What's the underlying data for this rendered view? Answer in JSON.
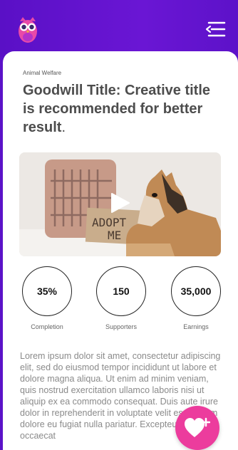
{
  "colors": {
    "header": "#5b12c8",
    "accent": "#ec3c9d",
    "title": "#4d4d4d",
    "body_text": "#8a8a8a"
  },
  "header": {
    "logo_icon": "owl-icon",
    "menu_icon": "menu-collapse-icon"
  },
  "article": {
    "category": "Animal Welfare",
    "title": "Goodwill Title: Creative title is recommended for better result",
    "title_end": ".",
    "video": {
      "play_icon": "play-icon",
      "sign_text_1": "ADOPT",
      "sign_text_2": "ME"
    }
  },
  "stats": [
    {
      "value": "35%",
      "label": "Completion"
    },
    {
      "value": "150",
      "label": "Supporters"
    },
    {
      "value": "35,000",
      "label": "Earnings"
    }
  ],
  "body": "Lorem ipsum dolor sit amet, consectetur adipiscing elit, sed do eiusmod tempor incididunt ut labore et dolore magna aliqua. Ut enim ad minim veniam, quis nostrud exercitation ullamco laboris nisi ut aliquip ex ea commodo consequat. Duis aute irure dolor in reprehenderit in voluptate velit esse cillum dolore eu fugiat nulla pariatur. Excepteur sint occaecat",
  "fab": {
    "icon": "heart-plus-icon"
  }
}
